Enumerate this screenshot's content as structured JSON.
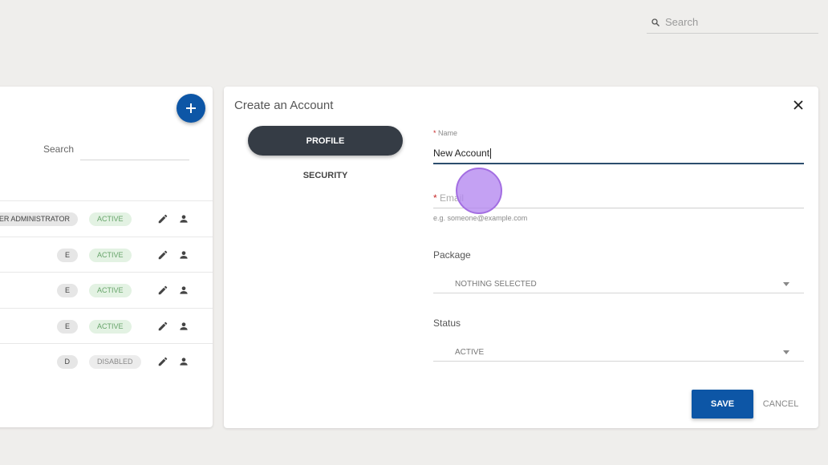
{
  "top_search": {
    "placeholder": "Search"
  },
  "left_panel": {
    "search_label": "Search",
    "rows": [
      {
        "role": "UPER ADMINISTRATOR",
        "status": "ACTIVE"
      },
      {
        "role": "E",
        "status": "ACTIVE"
      },
      {
        "role": "E",
        "status": "ACTIVE"
      },
      {
        "role": "E",
        "status": "ACTIVE"
      },
      {
        "role": "D",
        "status": "DISABLED"
      }
    ]
  },
  "form": {
    "title": "Create an Account",
    "tabs": {
      "profile": "PROFILE",
      "security": "SECURITY"
    },
    "name_label": "Name",
    "name_value": "New Account",
    "email_label": "Email",
    "email_hint": "e.g. someone@example.com",
    "required_mark": "*",
    "package_label": "Package",
    "package_value": "NOTHING SELECTED",
    "status_label": "Status",
    "status_value": "ACTIVE",
    "save_label": "SAVE",
    "cancel_label": "CANCEL"
  },
  "colors": {
    "primary": "#0d56a6",
    "tab_active": "#353c45",
    "active_chip_text": "#67a46a",
    "required": "#c62828"
  }
}
